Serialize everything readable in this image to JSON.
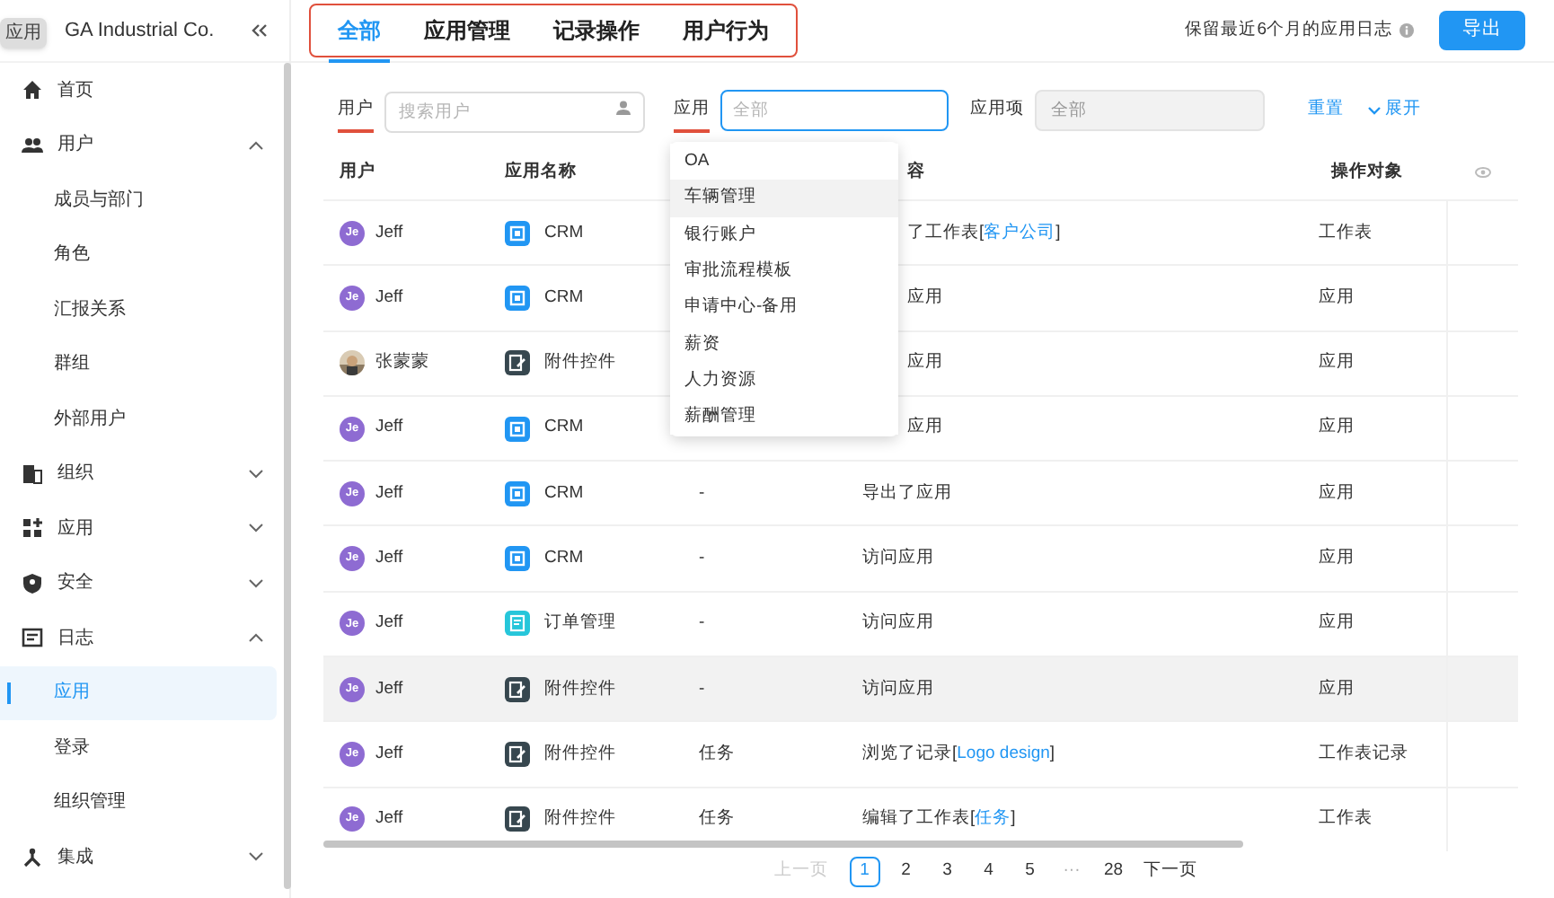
{
  "sidebar": {
    "tooltip": "应用",
    "brand": "GA Industrial Co.",
    "items": [
      {
        "label": "首页"
      },
      {
        "label": "用户",
        "expanded": true,
        "children": [
          {
            "label": "成员与部门",
            "selected": false
          },
          {
            "label": "角色",
            "selected": false
          },
          {
            "label": "汇报关系",
            "selected": false
          },
          {
            "label": "群组",
            "selected": false
          },
          {
            "label": "外部用户",
            "selected": false
          }
        ]
      },
      {
        "label": "组织",
        "expanded": false
      },
      {
        "label": "应用",
        "expanded": false
      },
      {
        "label": "安全",
        "expanded": false
      },
      {
        "label": "日志",
        "expanded": true,
        "children": [
          {
            "label": "应用",
            "selected": true
          },
          {
            "label": "登录",
            "selected": false
          },
          {
            "label": "组织管理",
            "selected": false
          }
        ]
      },
      {
        "label": "集成",
        "expanded": false
      }
    ]
  },
  "tabs": [
    {
      "label": "全部",
      "selected": true
    },
    {
      "label": "应用管理",
      "selected": false
    },
    {
      "label": "记录操作",
      "selected": false
    },
    {
      "label": "用户行为",
      "selected": false
    }
  ],
  "retention_note": "保留最近6个月的应用日志",
  "export_button": "导出",
  "filters": {
    "user": {
      "label": "用户",
      "underlined": true,
      "placeholder": "搜索用户"
    },
    "app": {
      "label": "应用",
      "underlined": true,
      "placeholder": "全部",
      "focused": true
    },
    "app_item": {
      "label": "应用项",
      "underlined": false,
      "placeholder": "全部",
      "disabled": true
    },
    "reset": "重置",
    "expand": "展开"
  },
  "dropdown": [
    {
      "label": "OA",
      "hovered": false
    },
    {
      "label": "车辆管理",
      "hovered": true
    },
    {
      "label": "银行账户",
      "hovered": false
    },
    {
      "label": "审批流程模板",
      "hovered": false
    },
    {
      "label": "申请中心-备用",
      "hovered": false
    },
    {
      "label": "薪资",
      "hovered": false
    },
    {
      "label": "人力资源",
      "hovered": false
    },
    {
      "label": "薪酬管理",
      "hovered": false
    }
  ],
  "table": {
    "columns": [
      "用户",
      "应用名称",
      "容",
      "操作对象"
    ],
    "rows": [
      {
        "user": "Jeff",
        "avatar": {
          "kind": "initials",
          "text": "Je"
        },
        "app": {
          "name": "CRM",
          "kind": "crm"
        },
        "content": {
          "before": "了工作表[",
          "link": "客户公司",
          "after": "]"
        },
        "object": "工作表",
        "hovered": false
      },
      {
        "user": "Jeff",
        "avatar": {
          "kind": "initials",
          "text": "Je"
        },
        "app": {
          "name": "CRM",
          "kind": "crm"
        },
        "content": {
          "before": "应用"
        },
        "object": "应用",
        "hovered": false
      },
      {
        "user": "张蒙蒙",
        "app": {
          "name": "附件控件",
          "kind": "attachment"
        },
        "content": {
          "before": "应用"
        },
        "object": "应用",
        "hovered": false
      },
      {
        "user": "Jeff",
        "avatar": {
          "kind": "initials",
          "text": "Je"
        },
        "app": {
          "name": "CRM",
          "kind": "crm"
        },
        "content": {
          "before": "应用"
        },
        "object": "应用",
        "hovered": false
      },
      {
        "user": "Jeff",
        "avatar": {
          "kind": "initials",
          "text": "Je"
        },
        "app": {
          "name": "CRM",
          "kind": "crm"
        },
        "column_3": "-",
        "content": {
          "before": "导出了应用"
        },
        "object": "应用",
        "hovered": false
      },
      {
        "user": "Jeff",
        "avatar": {
          "kind": "initials",
          "text": "Je"
        },
        "app": {
          "name": "CRM",
          "kind": "crm"
        },
        "column_3": "-",
        "content": {
          "before": "访问应用"
        },
        "object": "应用",
        "hovered": false
      },
      {
        "user": "Jeff",
        "avatar": {
          "kind": "initials",
          "text": "Je"
        },
        "app": {
          "name": "订单管理",
          "kind": "order"
        },
        "column_3": "-",
        "content": {
          "before": "访问应用"
        },
        "object": "应用",
        "hovered": false
      },
      {
        "user": "Jeff",
        "avatar": {
          "kind": "initials",
          "text": "Je"
        },
        "app": {
          "name": "附件控件",
          "kind": "attachment"
        },
        "column_3": "-",
        "content": {
          "before": "访问应用"
        },
        "object": "应用",
        "hovered": true
      },
      {
        "user": "Jeff",
        "avatar": {
          "kind": "initials",
          "text": "Je"
        },
        "app": {
          "name": "附件控件",
          "kind": "attachment"
        },
        "column_3": "任务",
        "content": {
          "before": "浏览了记录[",
          "link": "Logo design",
          "after": "]"
        },
        "object": "工作表记录",
        "hovered": false
      },
      {
        "user": "Jeff",
        "avatar": {
          "kind": "initials",
          "text": "Je"
        },
        "app": {
          "name": "附件控件",
          "kind": "attachment"
        },
        "column_3": "任务",
        "content": {
          "before": "编辑了工作表[",
          "link": "任务",
          "after": "]"
        },
        "object": "工作表",
        "hovered": false
      }
    ]
  },
  "pagination": {
    "prev": {
      "label": "上一页",
      "disabled": true
    },
    "pages": [
      {
        "label": "1",
        "selected": true
      },
      {
        "label": "2",
        "selected": false
      },
      {
        "label": "3",
        "selected": false
      },
      {
        "label": "4",
        "selected": false
      },
      {
        "label": "5",
        "selected": false
      }
    ],
    "ellipsis": "···",
    "last": {
      "label": "28",
      "selected": false
    },
    "next": {
      "label": "下一页",
      "disabled": false
    }
  }
}
